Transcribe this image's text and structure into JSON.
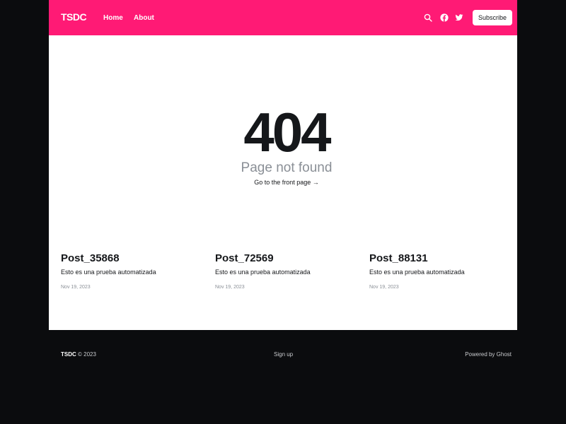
{
  "colors": {
    "accent": "#ff1a75",
    "page_bg": "#0b0c0e",
    "content_bg": "#ffffff",
    "text": "#15171a",
    "muted": "#8a8f96"
  },
  "header": {
    "logo": "TSDC",
    "nav": [
      {
        "label": "Home"
      },
      {
        "label": "About"
      }
    ],
    "icons": [
      "search-icon",
      "facebook-icon",
      "twitter-icon"
    ],
    "subscribe_label": "Subscribe"
  },
  "error": {
    "code": "404",
    "message": "Page not found",
    "link_text": "Go to the front page →"
  },
  "posts": [
    {
      "title": "Post_35868",
      "excerpt": "Esto es una prueba automatizada",
      "date": "Nov 19, 2023"
    },
    {
      "title": "Post_72569",
      "excerpt": "Esto es una prueba automatizada",
      "date": "Nov 19, 2023"
    },
    {
      "title": "Post_88131",
      "excerpt": "Esto es una prueba automatizada",
      "date": "Nov 19, 2023"
    }
  ],
  "footer": {
    "brand": "TSDC",
    "copyright": " © 2023",
    "signup": "Sign up",
    "powered": "Powered by Ghost"
  }
}
